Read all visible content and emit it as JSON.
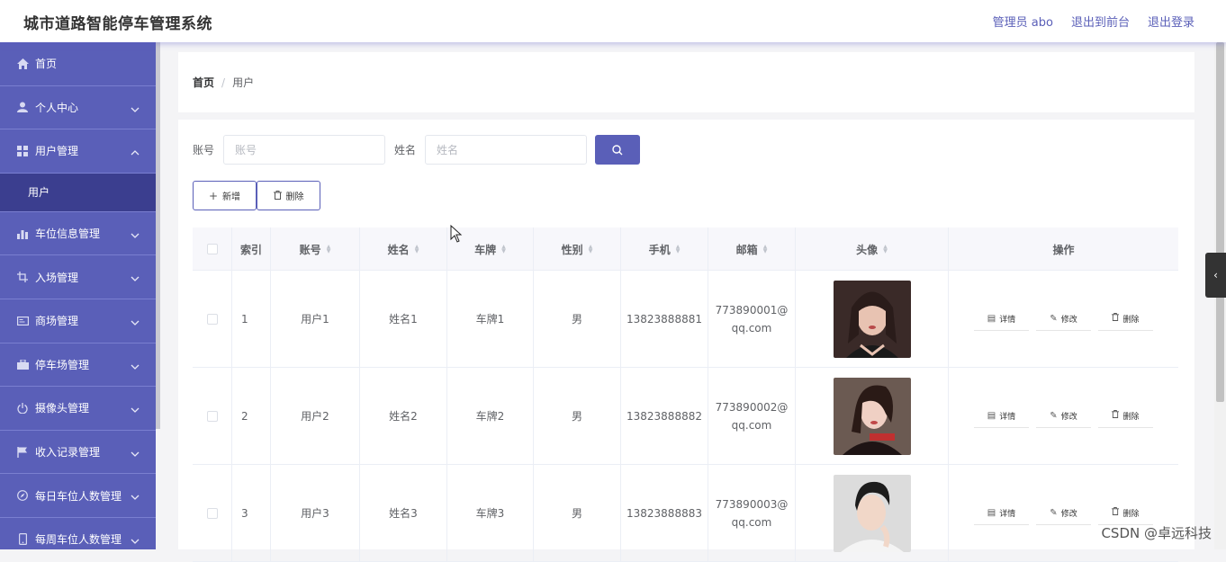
{
  "header": {
    "title": "城市道路智能停车管理系统",
    "user": "管理员 abo",
    "front": "退出到前台",
    "logout": "退出登录"
  },
  "sidebar": {
    "items": [
      {
        "label": "首页",
        "icon": "home-icon",
        "has_chevron": false
      },
      {
        "label": "个人中心",
        "icon": "user-icon",
        "has_chevron": true
      },
      {
        "label": "用户管理",
        "icon": "grid-icon",
        "has_chevron": true,
        "expanded": true
      },
      {
        "label": "车位信息管理",
        "icon": "bar-chart-icon",
        "has_chevron": true
      },
      {
        "label": "入场管理",
        "icon": "crop-icon",
        "has_chevron": true
      },
      {
        "label": "商场管理",
        "icon": "id-card-icon",
        "has_chevron": true
      },
      {
        "label": "停车场管理",
        "icon": "briefcase-icon",
        "has_chevron": true
      },
      {
        "label": "摄像头管理",
        "icon": "power-icon",
        "has_chevron": true
      },
      {
        "label": "收入记录管理",
        "icon": "flag-icon",
        "has_chevron": true
      },
      {
        "label": "每日车位人数管理",
        "icon": "compass-icon",
        "has_chevron": true
      },
      {
        "label": "每周车位人数管理",
        "icon": "phone-icon",
        "has_chevron": true
      }
    ],
    "submenu_active": "用户"
  },
  "breadcrumb": {
    "home": "首页",
    "separator": "/",
    "current": "用户"
  },
  "search": {
    "account_label": "账号",
    "account_placeholder": "账号",
    "name_label": "姓名",
    "name_placeholder": "姓名"
  },
  "actions": {
    "add": "新增",
    "delete": "删除"
  },
  "table": {
    "headers": [
      "索引",
      "账号",
      "姓名",
      "车牌",
      "性别",
      "手机",
      "邮箱",
      "头像",
      "操作"
    ],
    "rows": [
      {
        "index": "1",
        "account": "用户1",
        "name": "姓名1",
        "plate": "车牌1",
        "gender": "男",
        "phone": "13823888881",
        "email1": "773890001@",
        "email2": "qq.com"
      },
      {
        "index": "2",
        "account": "用户2",
        "name": "姓名2",
        "plate": "车牌2",
        "gender": "男",
        "phone": "13823888882",
        "email1": "773890002@",
        "email2": "qq.com"
      },
      {
        "index": "3",
        "account": "用户3",
        "name": "姓名3",
        "plate": "车牌3",
        "gender": "男",
        "phone": "13823888883",
        "email1": "773890003@",
        "email2": "qq.com"
      }
    ],
    "op_labels": {
      "detail": "详情",
      "edit": "修改",
      "delete": "删除"
    }
  },
  "watermark": "CSDN @卓远科技",
  "colors": {
    "primary": "#5a5fb8",
    "sidebar_active": "#3b3e8f"
  }
}
